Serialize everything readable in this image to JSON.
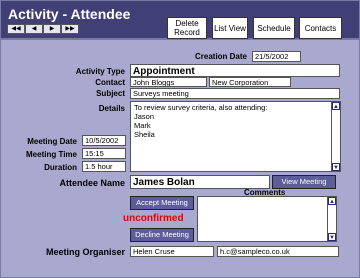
{
  "header": {
    "title": "Activity - Attendee",
    "nav": [
      "◀◀",
      "◀",
      "▶",
      "▶▶"
    ],
    "buttons": {
      "delete": "Delete Record",
      "list": "List View",
      "schedule": "Schedule",
      "contacts": "Contacts"
    }
  },
  "form": {
    "creation_date": {
      "label": "Creation Date",
      "value": "21/5/2002"
    },
    "activity_type": {
      "label": "Activity Type",
      "value": "Appointment"
    },
    "contact": {
      "label": "Contact",
      "name": "John Bloggs",
      "company": "New Corporation"
    },
    "subject": {
      "label": "Subject",
      "value": "Surveys meeting"
    },
    "details": {
      "label": "Details",
      "lines": [
        "To review survey criteria, also attending:",
        "Jason",
        "Mark",
        "Sheila"
      ]
    },
    "meeting_date": {
      "label": "Meeting Date",
      "value": "10/5/2002"
    },
    "meeting_time": {
      "label": "Meeting Time",
      "value": "15:15"
    },
    "duration": {
      "label": "Duration",
      "value": "1.5 hour"
    },
    "attendee_name": {
      "label": "Attendee Name",
      "value": "James Bolan"
    },
    "view_meeting": "View Meeting",
    "comments": {
      "label": "Comments",
      "value": ""
    },
    "accept": "Accept Meeting",
    "decline": "Decline Meeting",
    "status": "unconfirmed",
    "organiser": {
      "label": "Meeting Organiser",
      "name": "Helen Cruse",
      "email": "h.c@sampleco.co.uk"
    }
  },
  "colors": {
    "header_bg": "#404077",
    "panel_bg": "#a9a9cf",
    "button_bg": "#5d5d9a",
    "status": "#e60000"
  }
}
